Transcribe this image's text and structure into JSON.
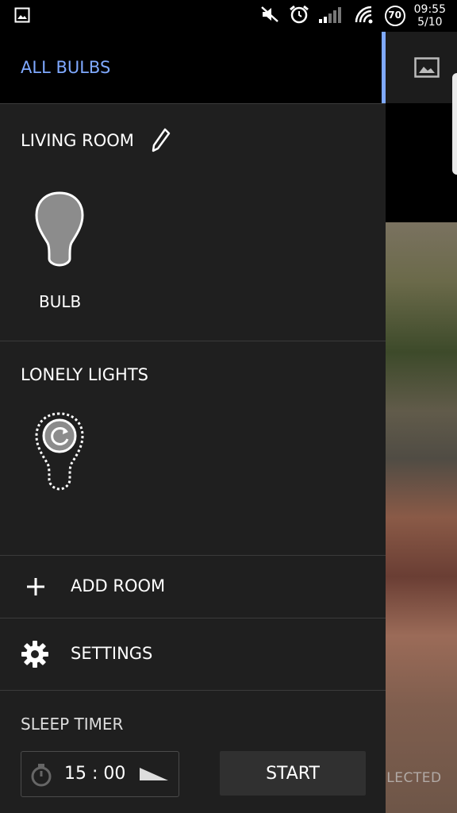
{
  "status_bar": {
    "time": "09:55",
    "date": "5/10",
    "battery": "70",
    "icons": [
      "image-icon",
      "mute-icon",
      "alarm-icon",
      "signal-icon",
      "wifi-icon",
      "battery-icon"
    ]
  },
  "drawer": {
    "header": {
      "title": "ALL BULBS"
    },
    "rooms": [
      {
        "name": "LIVING ROOM",
        "bulbs": [
          {
            "label": "BULB"
          }
        ]
      },
      {
        "name": "LONELY LIGHTS",
        "bulbs": []
      }
    ],
    "menu": {
      "add_room": "ADD ROOM",
      "settings": "SETTINGS"
    },
    "sleep_timer": {
      "title": "SLEEP TIMER",
      "time": "15 : 00",
      "start": "START"
    }
  },
  "background": {
    "selected_text": "ELECTED"
  },
  "colors": {
    "accent": "#7fa9ff",
    "drawer_bg": "#1f1f1f",
    "header_bg": "#000000"
  }
}
